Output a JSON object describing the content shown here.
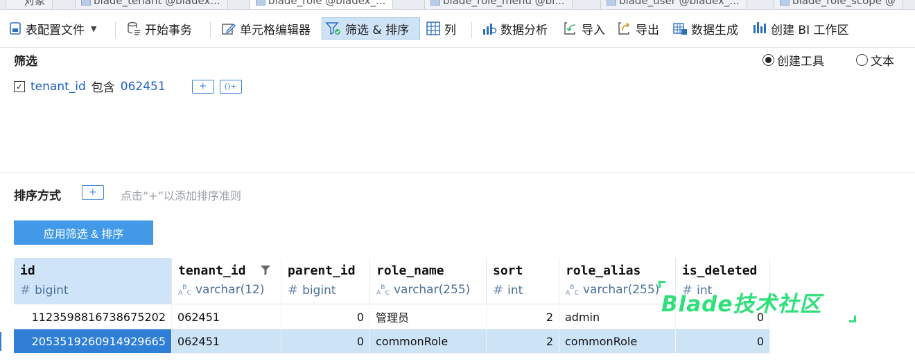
{
  "tabs": [
    {
      "label": "对象",
      "active": false
    },
    {
      "label": "blade_tenant @bladex...",
      "active": false
    },
    {
      "label": "blade_role @bladex_...",
      "active": true
    },
    {
      "label": "blade_role_menu @bl...",
      "active": false
    },
    {
      "label": "blade_user @bladex_...",
      "active": false
    },
    {
      "label": "blade_role_scope @",
      "active": false
    }
  ],
  "toolbar": {
    "config_file": "表配置文件",
    "begin_txn": "开始事务",
    "cell_editor": "单元格编辑器",
    "filter_sort": "筛选 & 排序",
    "columns": "列",
    "data_analysis": "数据分析",
    "import": "导入",
    "export": "导出",
    "data_generate": "数据生成",
    "create_bi": "创建 BI 工作区"
  },
  "filter": {
    "title": "筛选",
    "mode_builder": "创建工具",
    "mode_text": "文本",
    "selected_mode": "创建工具",
    "rule": {
      "field": "tenant_id",
      "operator": "包含",
      "value": "062451",
      "checked": true
    },
    "add_button": "+",
    "add_group_button": "()+"
  },
  "sort": {
    "title": "排序方式",
    "add_button": "+",
    "hint": "点击“+”以添加排序准则"
  },
  "apply_button": "应用筛选 & 排序",
  "grid": {
    "columns": [
      {
        "name": "id",
        "type": "bigint",
        "type_glyph": "#"
      },
      {
        "name": "tenant_id",
        "type": "varchar(12)",
        "type_glyph": "ABC",
        "filtered": true
      },
      {
        "name": "parent_id",
        "type": "bigint",
        "type_glyph": "#"
      },
      {
        "name": "role_name",
        "type": "varchar(255)",
        "type_glyph": "ABC"
      },
      {
        "name": "sort",
        "type": "int",
        "type_glyph": "#"
      },
      {
        "name": "role_alias",
        "type": "varchar(255)",
        "type_glyph": "ABC"
      },
      {
        "name": "is_deleted",
        "type": "int",
        "type_glyph": "#"
      }
    ],
    "rows": [
      {
        "id": "1123598816738675202",
        "tenant_id": "062451",
        "parent_id": "0",
        "role_name": "管理员",
        "sort": "2",
        "role_alias": "admin",
        "is_deleted": "0"
      },
      {
        "id": "2053519260914929665",
        "tenant_id": "062451",
        "parent_id": "0",
        "role_name": "commonRole",
        "sort": "2",
        "role_alias": "commonRole",
        "is_deleted": "0"
      }
    ],
    "selected_row": 1
  },
  "watermark": "Blade技术社区",
  "colors": {
    "accent": "#4199e8",
    "selection": "#cde4f7",
    "focus": "#2f7fd6",
    "link": "#1a5fc8",
    "watermark": "#2fe07a"
  }
}
